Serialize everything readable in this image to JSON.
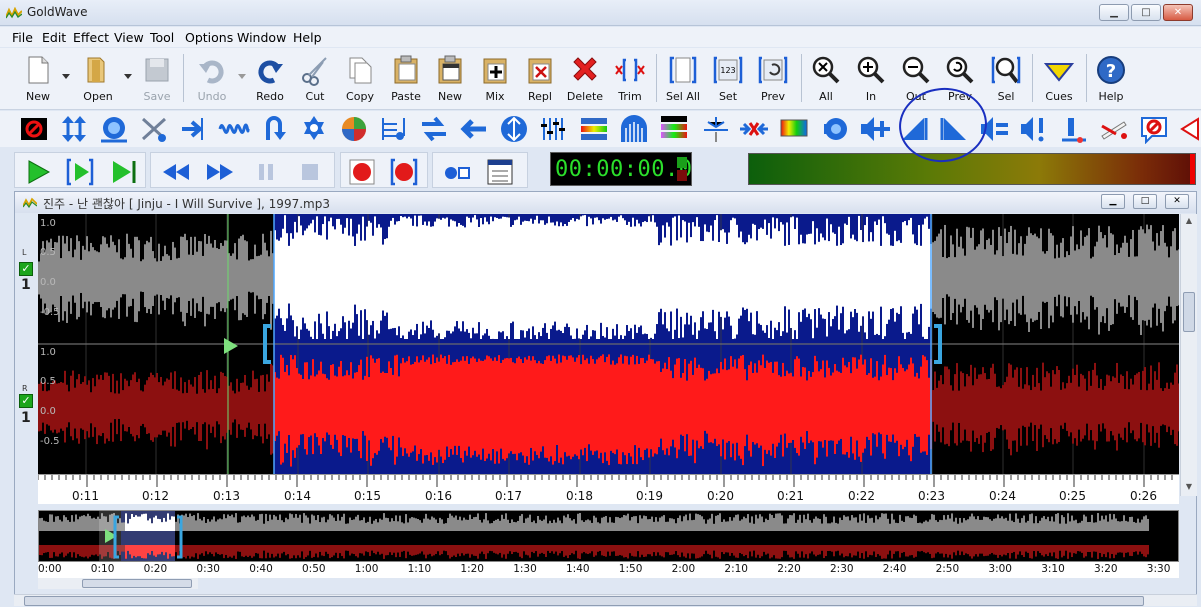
{
  "app": {
    "title": "GoldWave"
  },
  "window_controls": {
    "minimize": "▁",
    "maximize": "□",
    "close": "✕"
  },
  "menu": [
    "File",
    "Edit",
    "Effect",
    "View",
    "Tool",
    "Options",
    "Window",
    "Help"
  ],
  "toolbar_main": [
    {
      "label": "New",
      "icon": "new-file-icon",
      "enabled": true
    },
    {
      "label": "Open",
      "icon": "open-folder-icon",
      "enabled": true
    },
    {
      "label": "Save",
      "icon": "save-disk-icon",
      "enabled": false
    },
    {
      "label": "Undo",
      "icon": "undo-icon",
      "enabled": false
    },
    {
      "label": "Redo",
      "icon": "redo-icon",
      "enabled": true
    },
    {
      "label": "Cut",
      "icon": "scissors-icon",
      "enabled": true
    },
    {
      "label": "Copy",
      "icon": "copy-icon",
      "enabled": true
    },
    {
      "label": "Paste",
      "icon": "paste-icon",
      "enabled": true
    },
    {
      "label": "New",
      "icon": "paste-new-icon",
      "enabled": true
    },
    {
      "label": "Mix",
      "icon": "mix-icon",
      "enabled": true
    },
    {
      "label": "Repl",
      "icon": "replace-icon",
      "enabled": true
    },
    {
      "label": "Delete",
      "icon": "delete-icon",
      "enabled": true
    },
    {
      "label": "Trim",
      "icon": "trim-icon",
      "enabled": true
    },
    {
      "label": "Sel All",
      "icon": "select-all-icon",
      "enabled": true
    },
    {
      "label": "Set",
      "icon": "set-selection-icon",
      "enabled": true
    },
    {
      "label": "Prev",
      "icon": "previous-selection-icon",
      "enabled": true
    },
    {
      "label": "All",
      "icon": "zoom-all-icon",
      "enabled": true
    },
    {
      "label": "In",
      "icon": "zoom-in-icon",
      "enabled": true
    },
    {
      "label": "Out",
      "icon": "zoom-out-icon",
      "enabled": true
    },
    {
      "label": "Prev",
      "icon": "zoom-previous-icon",
      "enabled": true
    },
    {
      "label": "Sel",
      "icon": "zoom-selection-icon",
      "enabled": true
    },
    {
      "label": "Cues",
      "icon": "cues-icon",
      "enabled": true
    },
    {
      "label": "Help",
      "icon": "help-icon",
      "enabled": true
    }
  ],
  "transport": {
    "counter": "00:00:00.0"
  },
  "sound_window": {
    "title": "진주 - 난 괜찮아 [ Jinju - I Will Survive ], 1997.mp3",
    "channels": [
      {
        "letter": "L",
        "number": "1",
        "checked": "✓"
      },
      {
        "letter": "R",
        "number": "1",
        "checked": "✓"
      }
    ],
    "amplitude_labels": [
      "1.0",
      "0.5",
      "0.0",
      "-0.5"
    ],
    "timeline_labels": [
      "0:11",
      "0:12",
      "0:13",
      "0:14",
      "0:15",
      "0:16",
      "0:17",
      "0:18",
      "0:19",
      "0:20",
      "0:21",
      "0:22",
      "0:23",
      "0:24",
      "0:25",
      "0:26"
    ],
    "overview_labels": [
      "0:00",
      "0:10",
      "0:20",
      "0:30",
      "0:40",
      "0:50",
      "1:00",
      "1:10",
      "1:20",
      "1:30",
      "1:40",
      "1:50",
      "2:00",
      "2:10",
      "2:20",
      "2:30",
      "2:40",
      "2:50",
      "3:00",
      "3:10",
      "3:20",
      "3:30"
    ]
  },
  "colors": {
    "left_channel_wave": "#ffffff",
    "right_channel_wave": "#ff1a1a",
    "selection_bg": "#0a1a8c",
    "counter_text": "#2be02b",
    "annotation_circle": "#1a2fc0"
  }
}
